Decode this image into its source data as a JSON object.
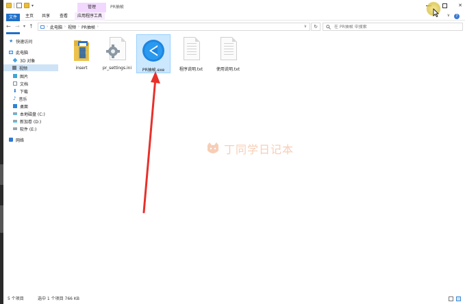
{
  "window": {
    "title": "PR抽帧",
    "context_tab": "管理",
    "ribbon_tabs": [
      "文件",
      "主页",
      "共享",
      "查看",
      "应用程序工具"
    ]
  },
  "address": {
    "crumbs": [
      "此电脑",
      "视频",
      "PR抽帧"
    ],
    "search_placeholder": "在 PR抽帧 中搜索"
  },
  "nav": {
    "items": [
      {
        "label": "快速访问",
        "icon": "star-icon"
      },
      {
        "label": "此电脑",
        "icon": "computer-icon"
      },
      {
        "label": "3D 对象",
        "icon": "3d-objects-icon"
      },
      {
        "label": "视频",
        "icon": "videos-icon",
        "selected": true
      },
      {
        "label": "图片",
        "icon": "pictures-icon"
      },
      {
        "label": "文档",
        "icon": "documents-icon"
      },
      {
        "label": "下载",
        "icon": "downloads-icon"
      },
      {
        "label": "音乐",
        "icon": "music-icon"
      },
      {
        "label": "桌面",
        "icon": "desktop-icon"
      },
      {
        "label": "本地磁盘 (C:)",
        "icon": "drive-icon"
      },
      {
        "label": "新加卷 (D:)",
        "icon": "drive-icon"
      },
      {
        "label": "软件 (E:)",
        "icon": "drive-icon"
      },
      {
        "label": "网络",
        "icon": "network-icon"
      }
    ]
  },
  "files": [
    {
      "name": "insert",
      "kind": "folder"
    },
    {
      "name": "pr_settings.ini",
      "kind": "config"
    },
    {
      "name": "PR抽帧.exe",
      "kind": "exe",
      "selected": true
    },
    {
      "name": "程序说明.txt",
      "kind": "txt"
    },
    {
      "name": "使用说明.txt",
      "kind": "txt"
    }
  ],
  "status": {
    "count": "5 个项目",
    "selection": "选中 1 个项目  766 KB"
  },
  "watermark": "丁同学日记本",
  "colors": {
    "accent": "#1e6fc9",
    "selection": "#cce8ff",
    "annotation_arrow": "#e8302a",
    "context_tab": "#f2d8ff"
  }
}
